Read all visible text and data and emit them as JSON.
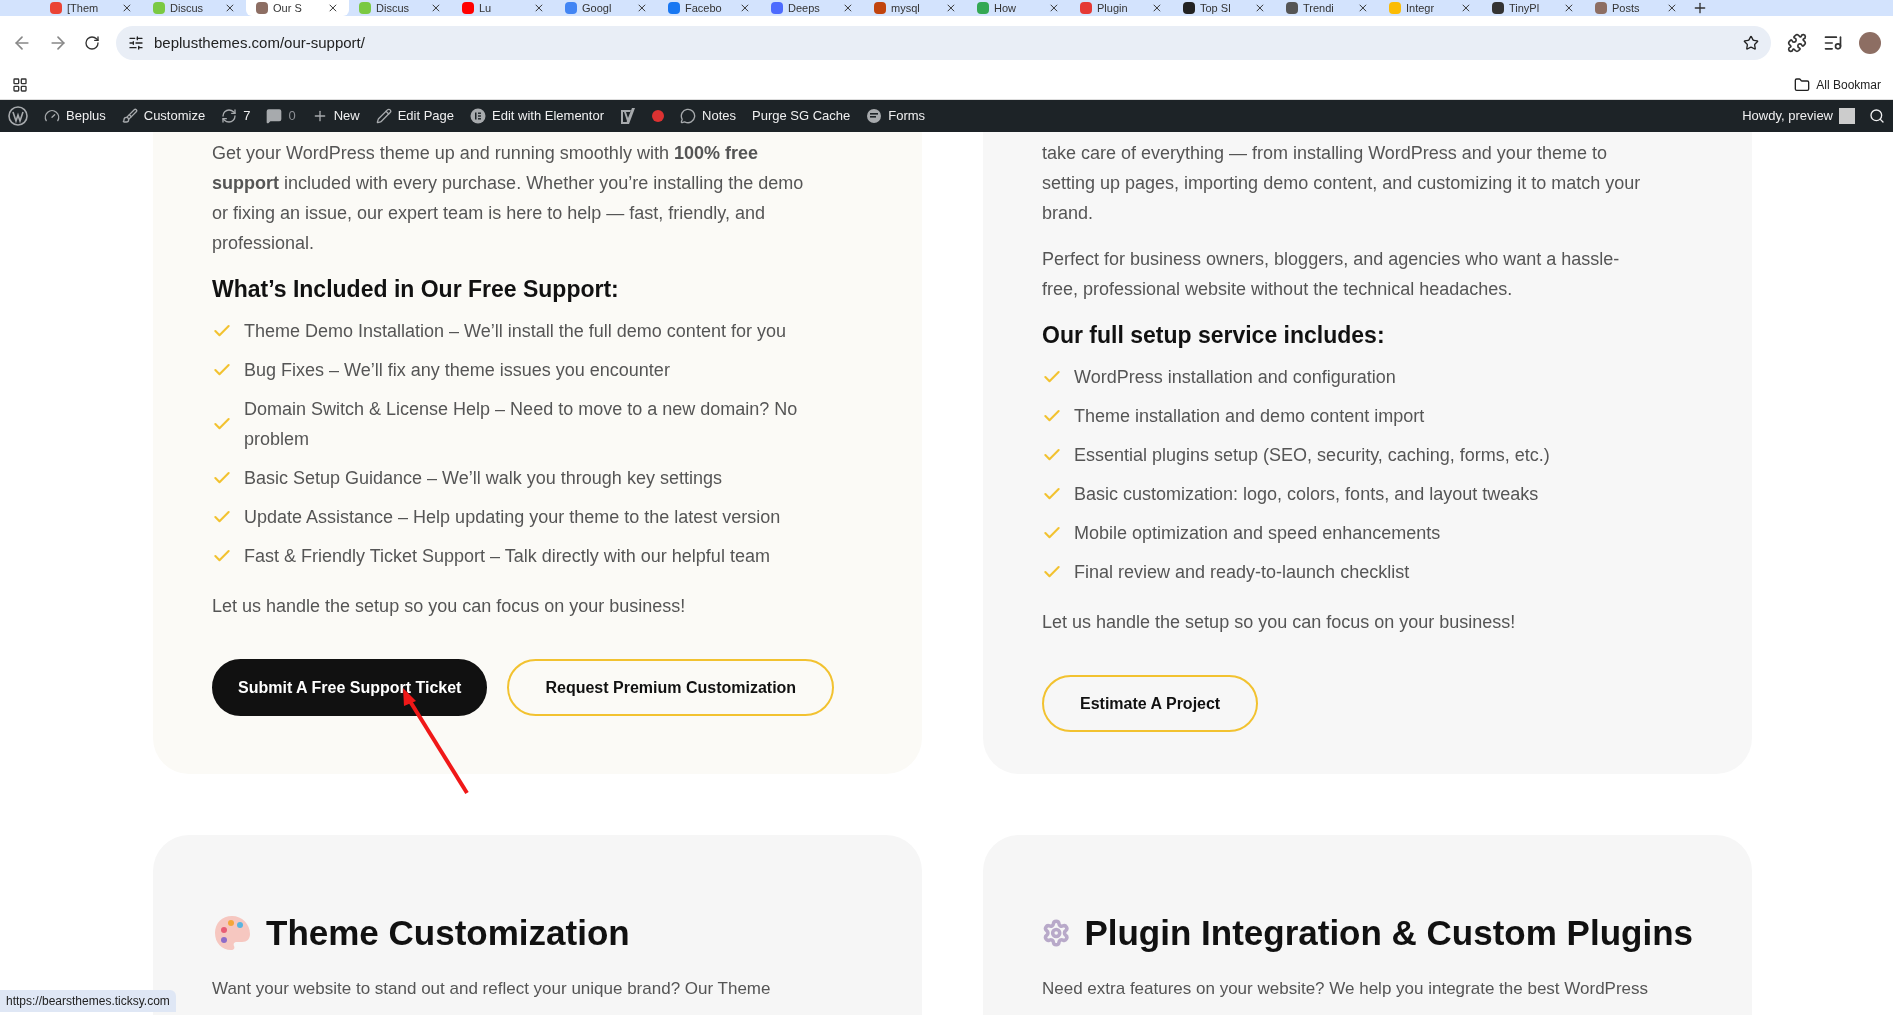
{
  "browser": {
    "tabs": [
      {
        "title": "[Them",
        "selected": false,
        "color": "#ea4335"
      },
      {
        "title": "Discus",
        "selected": false,
        "color": "#7ac943"
      },
      {
        "title": "Our S",
        "selected": true,
        "color": "#8d6e63"
      },
      {
        "title": "Discus",
        "selected": false,
        "color": "#7ac943"
      },
      {
        "title": "Lu",
        "selected": false,
        "color": "#ff0000"
      },
      {
        "title": "Googl",
        "selected": false,
        "color": "#4285f4"
      },
      {
        "title": "Facebo",
        "selected": false,
        "color": "#1877f2"
      },
      {
        "title": "Deeps",
        "selected": false,
        "color": "#4d6bfe"
      },
      {
        "title": "mysql",
        "selected": false,
        "color": "#c1440e"
      },
      {
        "title": "How",
        "selected": false,
        "color": "#34a853"
      },
      {
        "title": "Plugin",
        "selected": false,
        "color": "#e53935"
      },
      {
        "title": "Top Sl",
        "selected": false,
        "color": "#222222"
      },
      {
        "title": "Trendi",
        "selected": false,
        "color": "#555555"
      },
      {
        "title": "Integr",
        "selected": false,
        "color": "#fbbc05"
      },
      {
        "title": "TinyPl",
        "selected": false,
        "color": "#333333"
      },
      {
        "title": "Posts",
        "selected": false,
        "color": "#8d6e63"
      }
    ],
    "url": "beplusthemes.com/our-support/",
    "bookmarks": "All Bookmar",
    "status_url": "https://bearsthemes.ticksy.com"
  },
  "admin_bar": {
    "items": [
      {
        "kind": "wordpress"
      },
      {
        "kind": "gauge",
        "label": "Beplus"
      },
      {
        "kind": "brush",
        "label": "Customize"
      },
      {
        "kind": "refresh",
        "label": "7"
      },
      {
        "kind": "comment",
        "label": "0",
        "disabled": true
      },
      {
        "kind": "plus",
        "label": "New"
      },
      {
        "kind": "pencil",
        "label": "Edit Page"
      },
      {
        "kind": "elementor",
        "label": "Edit with Elementor"
      },
      {
        "kind": "yoast"
      },
      {
        "kind": "dot"
      },
      {
        "kind": "bubble",
        "label": "Notes"
      },
      {
        "kind": "text",
        "label": "Purge SG Cache"
      },
      {
        "kind": "forms",
        "label": "Forms"
      }
    ],
    "greeting": "Howdy, preview"
  },
  "support_card": {
    "paragraphs": [
      "Get your WordPress theme up and running smoothly with **100% free support** included with every purchase. Whether you’re installing the demo or fixing an issue, our expert team is here to help — fast, friendly, and professional."
    ],
    "heading": "What’s Included in Our Free Support:",
    "items": [
      "Theme Demo Installation – We’ll install the full demo content for you",
      "Bug Fixes – We’ll fix any theme issues you encounter",
      "Domain Switch & License Help – Need to move to a new domain? No problem",
      "Basic Setup Guidance – We’ll walk you through key settings",
      "Update Assistance – Help updating your theme to the latest version",
      "Fast & Friendly Ticket Support – Talk directly with our helpful team"
    ],
    "note": "Let us handle the setup so you can focus on your business!",
    "buttons": [
      {
        "label": "Submit A Free Support Ticket",
        "kind": "primary"
      },
      {
        "label": "Request Premium Customization",
        "kind": "outline"
      }
    ]
  },
  "setup_card": {
    "paragraphs": [
      "take care of everything — from installing WordPress and your theme to setting up pages, importing demo content, and customizing it to match your brand.",
      "Perfect for business owners, bloggers, and agencies who want a hassle-free, professional website without the technical headaches."
    ],
    "heading": "Our full setup service includes:",
    "items": [
      "WordPress installation and configuration",
      "Theme installation and demo content import",
      "Essential plugins setup (SEO, security, caching, forms, etc.)",
      "Basic customization: logo, colors, fonts, and layout tweaks",
      "Mobile optimization and speed enhancements",
      "Final review and ready-to-launch checklist"
    ],
    "note": "Let us handle the setup so you can focus on your business!",
    "buttons": [
      {
        "label": "Estimate A Project",
        "kind": "outline"
      }
    ]
  },
  "lower_cards": [
    {
      "kind": "palette",
      "title": "Theme Customization",
      "text": "Want your website to stand out and reflect your unique brand? Our Theme"
    },
    {
      "kind": "gear",
      "title": "Plugin Integration & Custom Plugins",
      "text": "Need extra features on your website? We help you integrate the best WordPress"
    }
  ]
}
